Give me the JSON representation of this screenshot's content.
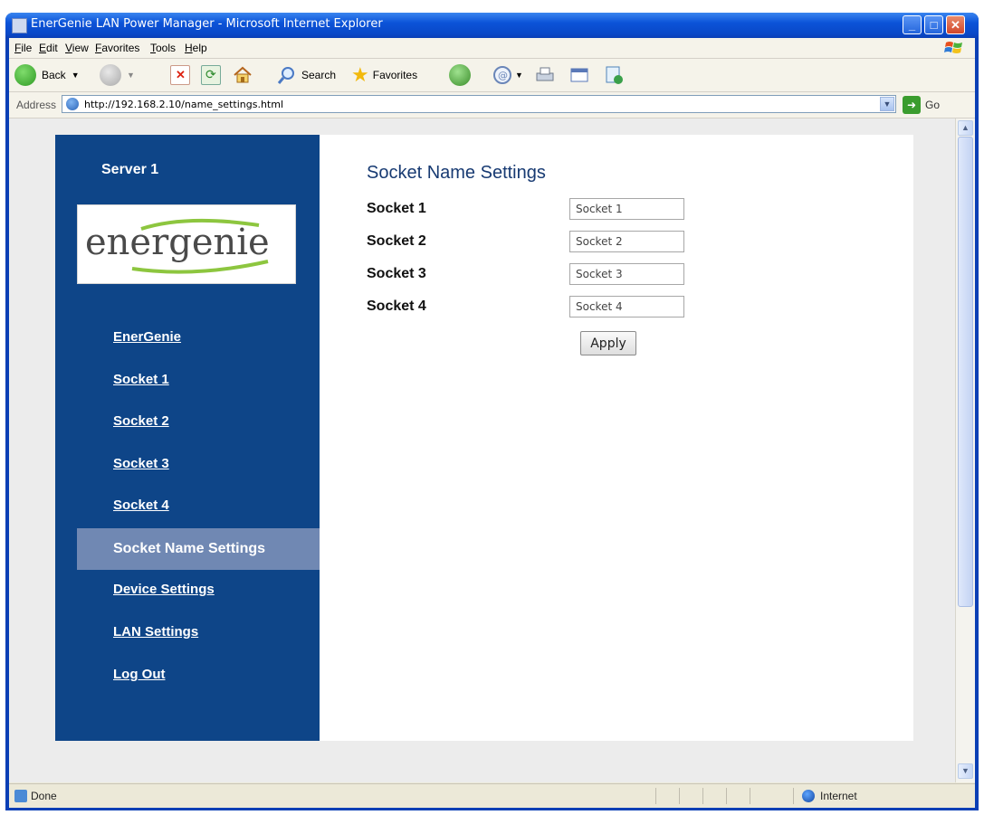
{
  "window": {
    "title": "EnerGenie LAN Power Manager - Microsoft Internet Explorer",
    "controls": {
      "minimize": "_",
      "maximize": "□",
      "close": "✕"
    }
  },
  "menubar": {
    "items": [
      "File",
      "Edit",
      "View",
      "Favorites",
      "Tools",
      "Help"
    ]
  },
  "toolbar": {
    "back_label": "Back",
    "search_label": "Search",
    "favorites_label": "Favorites"
  },
  "addressbar": {
    "label": "Address",
    "url": "http://192.168.2.10/name_settings.html",
    "go_label": "Go"
  },
  "sidebar": {
    "server_title": "Server 1",
    "logo_text": "energenie",
    "nav": [
      {
        "label": "EnerGenie"
      },
      {
        "label": "Socket 1"
      },
      {
        "label": "Socket 2"
      },
      {
        "label": "Socket 3"
      },
      {
        "label": "Socket 4"
      },
      {
        "label": "Socket Name Settings",
        "active": true
      },
      {
        "label": "Device Settings"
      },
      {
        "label": "LAN Settings"
      },
      {
        "label": "Log Out"
      }
    ]
  },
  "main": {
    "heading": "Socket Name Settings",
    "sockets": [
      {
        "label": "Socket 1",
        "value": "Socket 1"
      },
      {
        "label": "Socket 2",
        "value": "Socket 2"
      },
      {
        "label": "Socket 3",
        "value": "Socket 3"
      },
      {
        "label": "Socket 4",
        "value": "Socket 4"
      }
    ],
    "apply_label": "Apply"
  },
  "statusbar": {
    "status": "Done",
    "zone": "Internet"
  },
  "colors": {
    "sidebar_bg": "#0e4588",
    "active_nav_bg": "#7088b3",
    "heading": "#173a72",
    "logo_swoosh": "#8dc63f"
  }
}
